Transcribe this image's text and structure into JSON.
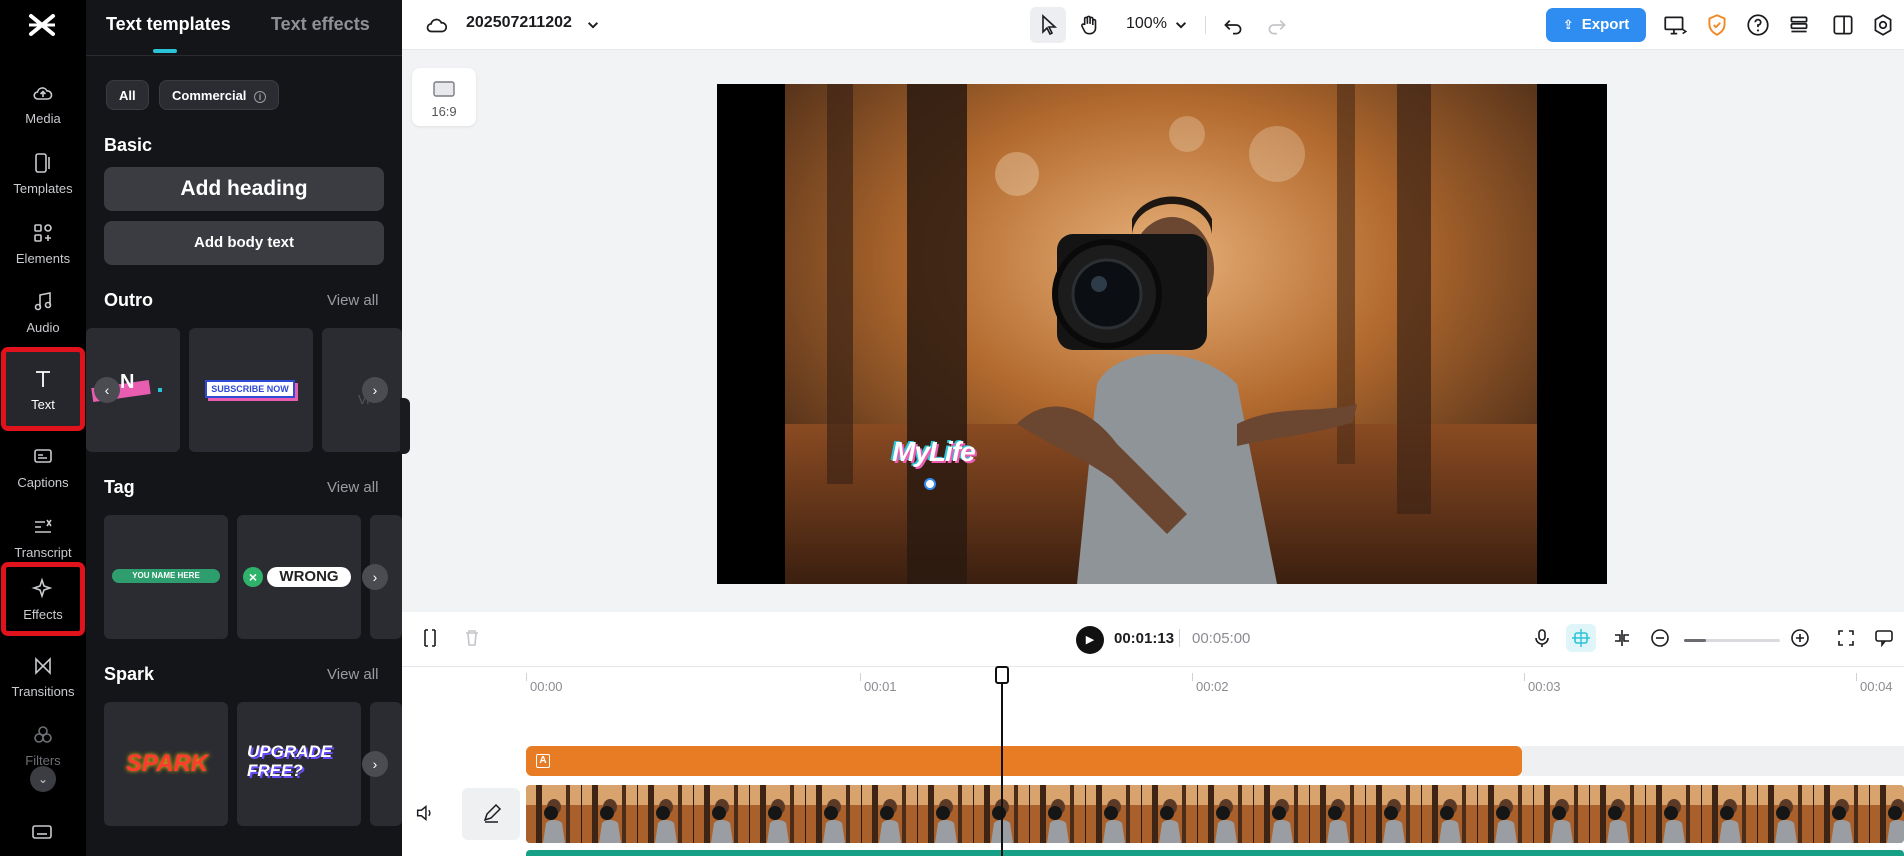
{
  "rail": {
    "items": [
      {
        "label": "Media",
        "icon": "cloud-upload-icon"
      },
      {
        "label": "Templates",
        "icon": "templates-icon"
      },
      {
        "label": "Elements",
        "icon": "elements-icon"
      },
      {
        "label": "Audio",
        "icon": "music-note-icon"
      },
      {
        "label": "Text",
        "icon": "text-t-icon"
      },
      {
        "label": "Captions",
        "icon": "captions-icon"
      },
      {
        "label": "Transcript",
        "icon": "transcript-icon"
      },
      {
        "label": "Effects",
        "icon": "sparkle-icon"
      },
      {
        "label": "Transitions",
        "icon": "transitions-icon"
      },
      {
        "label": "Filters",
        "icon": "filters-icon"
      }
    ]
  },
  "panel": {
    "tabs": [
      "Text templates",
      "Text effects"
    ],
    "chips": {
      "all": "All",
      "commercial": "Commercial"
    },
    "basic": {
      "title": "Basic",
      "add_heading": "Add heading",
      "add_body": "Add body text"
    },
    "outro": {
      "title": "Outro",
      "view_all": "View all",
      "card2_text": "SUBSCRIBE NOW"
    },
    "tag": {
      "title": "Tag",
      "view_all": "View all",
      "card1_text": "YOU NAME HERE",
      "card2_text": "WRONG"
    },
    "spark": {
      "title": "Spark",
      "view_all": "View all",
      "card1_text": "SPARK",
      "card2_text": "UPGRADE FREE?"
    }
  },
  "topbar": {
    "project_name": "202507211202",
    "zoom": "100%",
    "export_label": "Export"
  },
  "canvas": {
    "ratio_label": "16:9",
    "overlay_text": "MyLife"
  },
  "timeline": {
    "current_time": "00:01:13",
    "total_time": "00:05:00",
    "ticks": [
      "00:00",
      "00:01",
      "00:02",
      "00:03",
      "00:04"
    ],
    "zoom_fraction": 0.23
  },
  "colors": {
    "accent": "#2bc3d8",
    "export": "#2f8cf1",
    "highlight": "#e0131d",
    "text_track": "#e87c24",
    "audio_track": "#16a085"
  }
}
